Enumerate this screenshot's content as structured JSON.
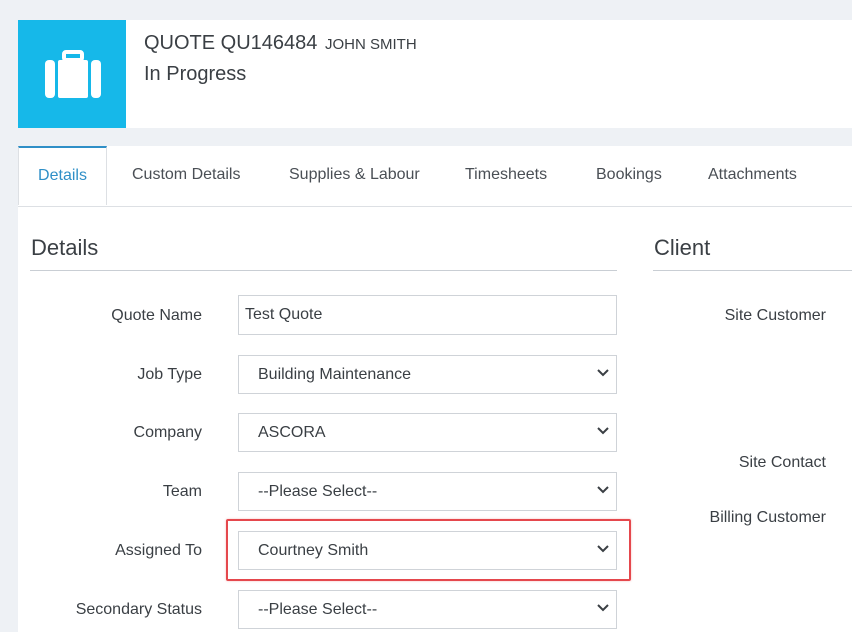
{
  "header": {
    "quote_number": "QUOTE QU146484",
    "client_name": "JOHN SMITH",
    "status": "In Progress",
    "icon": "briefcase-icon",
    "accent_color": "#16b8e9"
  },
  "tabs": [
    {
      "label": "Details",
      "active": true
    },
    {
      "label": "Custom Details",
      "active": false
    },
    {
      "label": "Supplies & Labour",
      "active": false
    },
    {
      "label": "Timesheets",
      "active": false
    },
    {
      "label": "Bookings",
      "active": false
    },
    {
      "label": "Attachments",
      "active": false
    }
  ],
  "details": {
    "title": "Details",
    "fields": {
      "quote_name": {
        "label": "Quote Name",
        "value": "Test Quote"
      },
      "job_type": {
        "label": "Job Type",
        "value": "Building Maintenance"
      },
      "company": {
        "label": "Company",
        "value": "ASCORA"
      },
      "team": {
        "label": "Team",
        "value": "--Please Select--"
      },
      "assigned_to": {
        "label": "Assigned To",
        "value": "Courtney Smith"
      },
      "secondary_status": {
        "label": "Secondary Status",
        "value": "--Please Select--"
      }
    }
  },
  "client": {
    "title": "Client",
    "site_customer_label": "Site Customer",
    "site_contact_label": "Site Contact",
    "billing_customer_label": "Billing Customer"
  },
  "highlight_color": "#e5484d"
}
